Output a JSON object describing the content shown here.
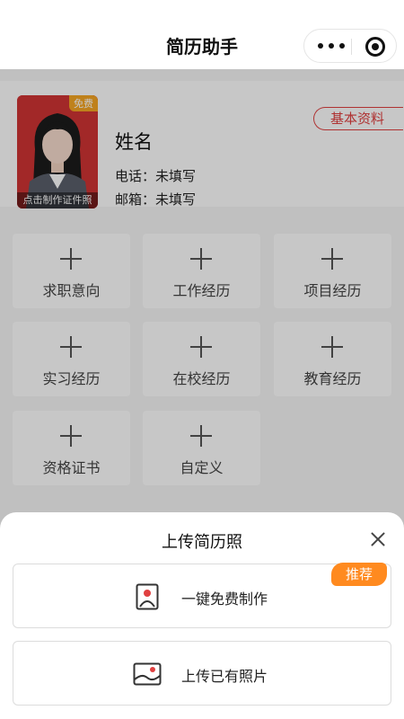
{
  "navbar": {
    "title": "简历助手"
  },
  "profile": {
    "photo_tag": "免费",
    "photo_caption": "点击制作证件照",
    "name": "姓名",
    "phone_label": "电话：",
    "phone_value": "未填写",
    "email_label": "邮箱：",
    "email_value": "未填写",
    "basic_info_label": "基本资料"
  },
  "sections": [
    {
      "label": "求职意向"
    },
    {
      "label": "工作经历"
    },
    {
      "label": "项目经历"
    },
    {
      "label": "实习经历"
    },
    {
      "label": "在校经历"
    },
    {
      "label": "教育经历"
    },
    {
      "label": "资格证书"
    },
    {
      "label": "自定义"
    }
  ],
  "sheet": {
    "title": "上传简历照",
    "options": [
      {
        "label": "一键免费制作",
        "icon": "portrait-icon",
        "badge": "推荐"
      },
      {
        "label": "上传已有照片",
        "icon": "image-icon"
      }
    ]
  },
  "colors": {
    "accent_red": "#e04040",
    "badge_orange": "#ff8a1f",
    "free_tag": "#f5a623"
  }
}
